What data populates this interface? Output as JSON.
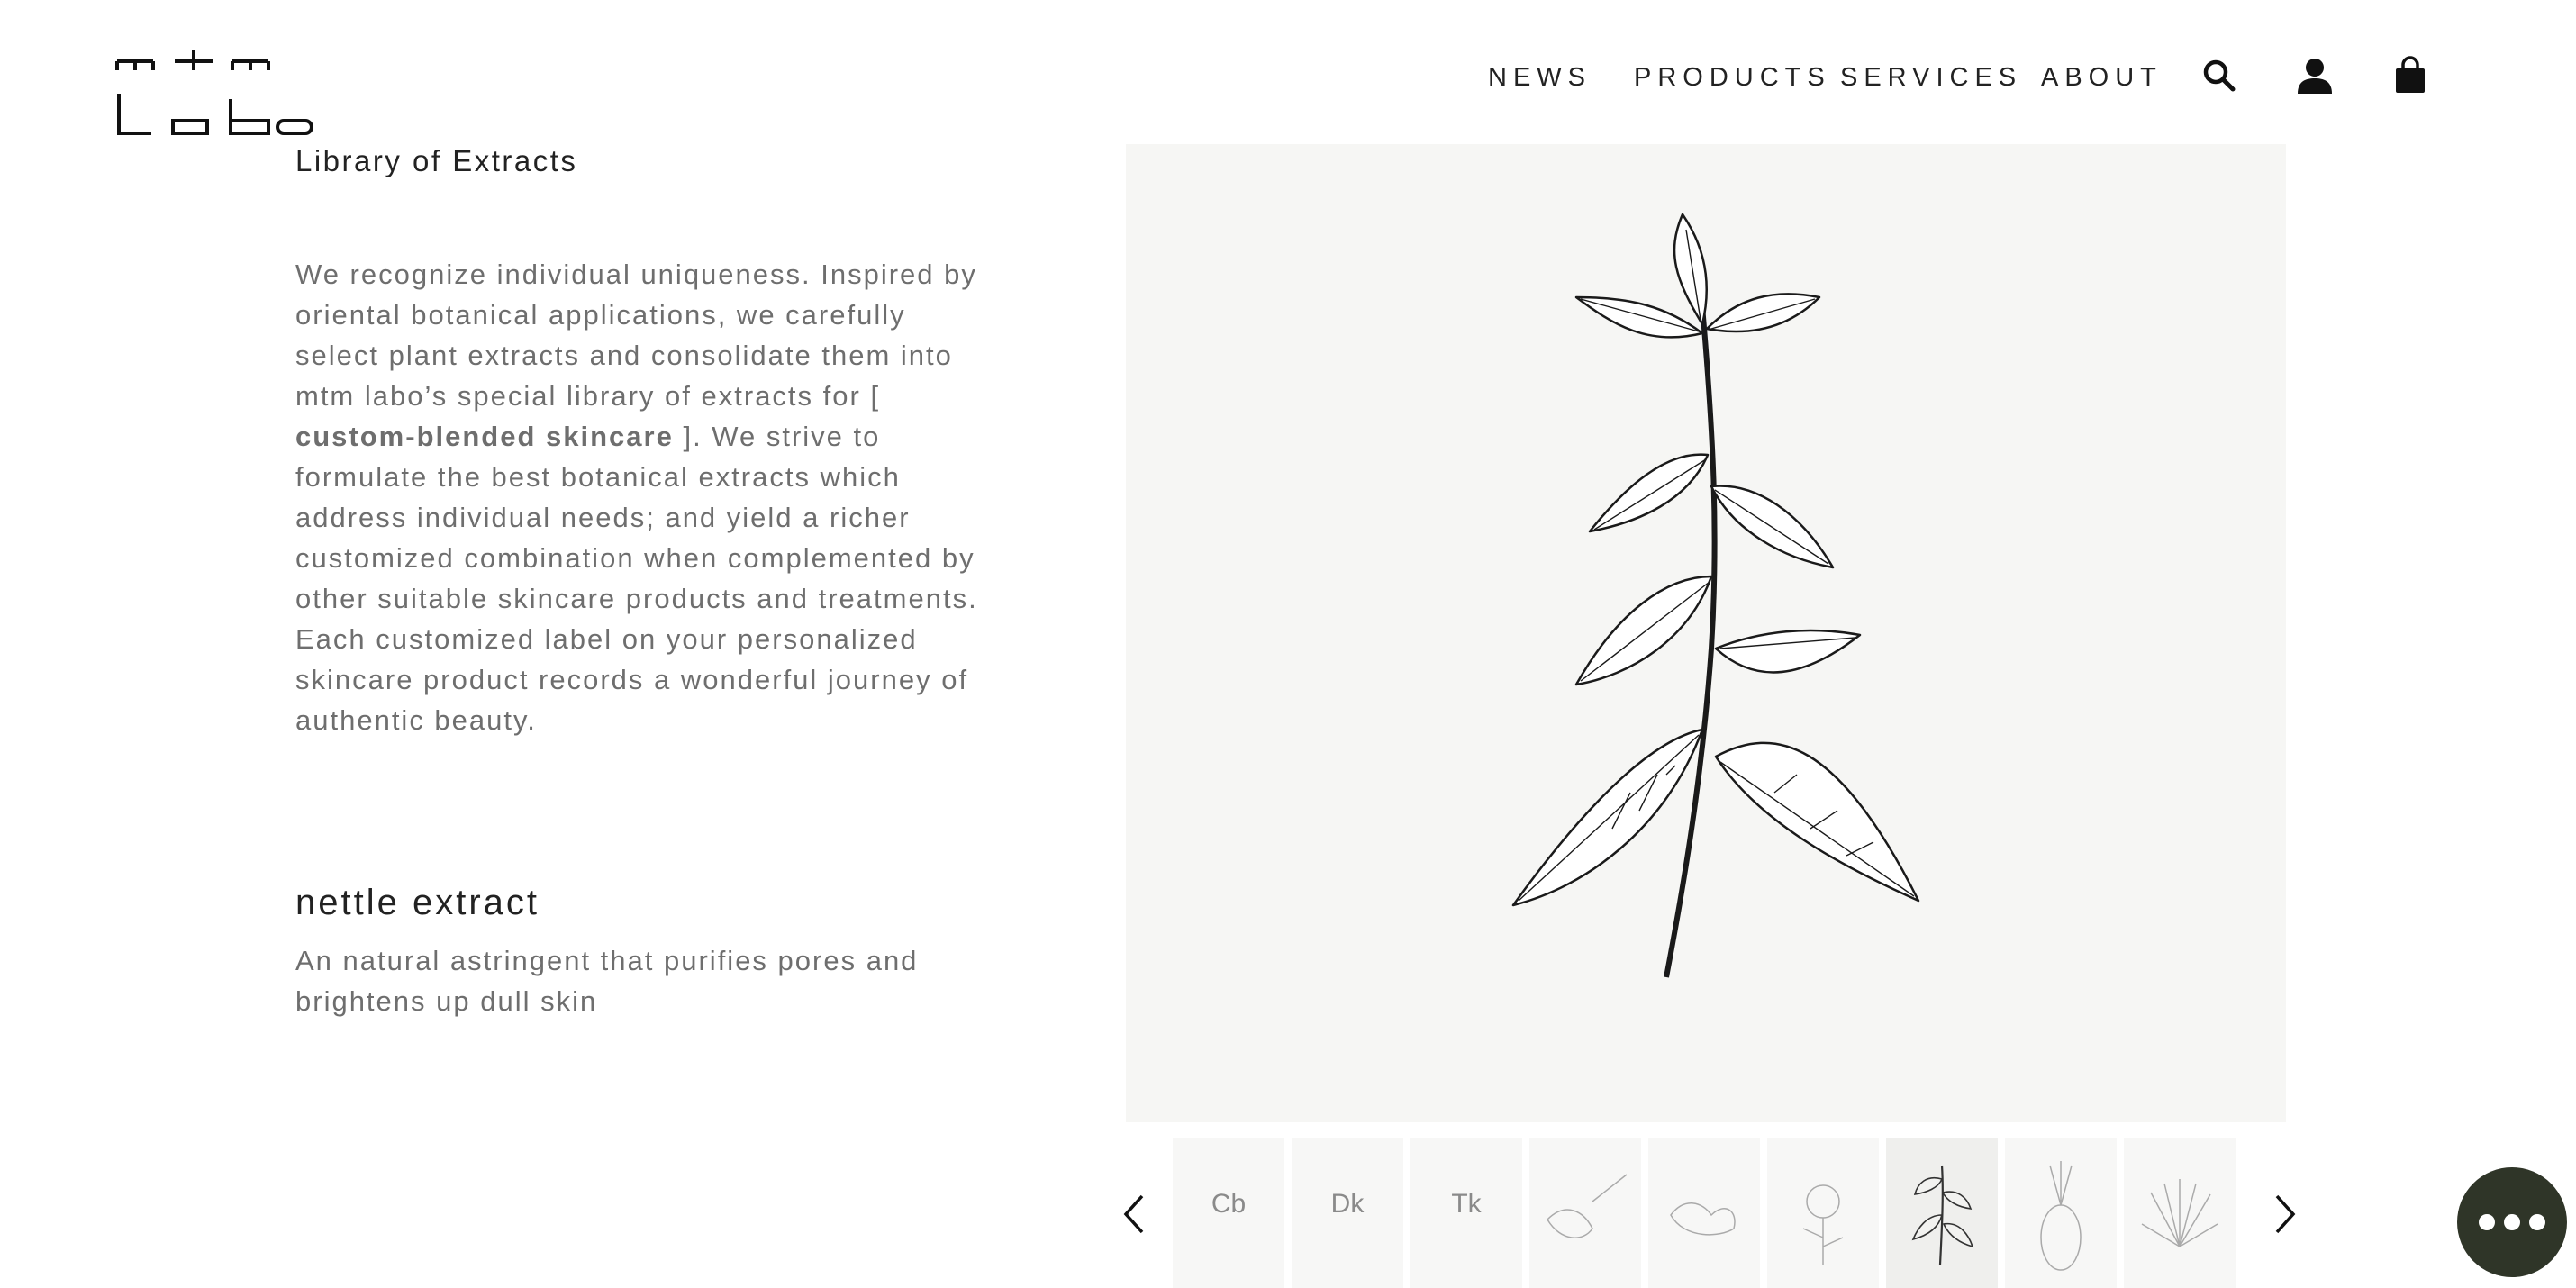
{
  "logo": {
    "alt": "mtm labo"
  },
  "nav": {
    "items": [
      "NEWS",
      "PRODUCTS",
      "SERVICES",
      "ABOUT"
    ],
    "icons": [
      "search-icon",
      "account-icon",
      "shopping-bag-icon"
    ]
  },
  "library": {
    "title": "Library of Extracts",
    "intro_part1": "We recognize individual uniqueness. Inspired by oriental botanical applications, we carefully select plant extracts and consolidate them into mtm labo’s special library of extracts for [ ",
    "intro_bold": "custom-blended skincare",
    "intro_part2": " ]. We strive to formulate the best botanical extracts which address individual needs; and yield a richer customized combination when complemented by other suitable skincare products and treatments. Each customized label on your personalized skincare product records a wonderful journey of authentic beauty."
  },
  "extract": {
    "name": "nettle extract",
    "description": "An natural astringent that purifies pores and brightens up dull skin"
  },
  "carousel": {
    "thumbnails": [
      {
        "letters": "Cb",
        "kind": "label"
      },
      {
        "letters": "Dk",
        "kind": "label"
      },
      {
        "letters": "Tk",
        "kind": "label"
      },
      {
        "letters": "",
        "kind": "honey-illustration"
      },
      {
        "letters": "",
        "kind": "ginger-illustration"
      },
      {
        "letters": "",
        "kind": "rose-illustration"
      },
      {
        "letters": "",
        "kind": "nettle-illustration",
        "active": true
      },
      {
        "letters": "",
        "kind": "pineapple-illustration"
      },
      {
        "letters": "",
        "kind": "aloe-illustration"
      }
    ]
  },
  "colors": {
    "hero_bg": "#f6f6f4",
    "chat_bg": "#2f3528",
    "body_text": "#6e6e6e"
  }
}
